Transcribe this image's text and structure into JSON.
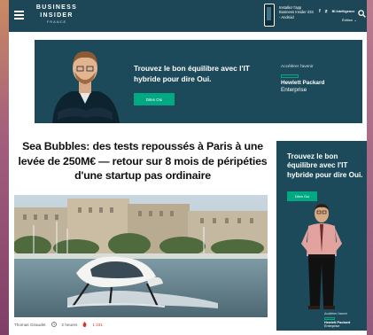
{
  "header": {
    "logo_line1": "BUSINESS",
    "logo_line2": "INSIDER",
    "logo_line3": "FRANCE",
    "app_promo": "Installez l'app Business Insider iOS - Android",
    "bi_intelligence": "BI Intelligence",
    "edition_label": "Édition ⌄",
    "colors": {
      "bar": "#1d4656",
      "accent": "#01a982"
    }
  },
  "ad_top": {
    "headline": "Trouvez le bon équilibre avec l'IT hybride pour dire Oui.",
    "cta_label": "Dites Oui",
    "caption": "Accélérer l'avenir",
    "brand_line1": "Hewlett Packard",
    "brand_line2": "Enterprise"
  },
  "article": {
    "headline": "Sea Bubbles: des tests repoussés à Paris à une levée de 250M€ — retour sur 8 mois de péripéties d'une startup pas ordinaire",
    "author": "Thomas Giraudet",
    "time": "2 heures",
    "views": "1 231",
    "photo_icon": "sea-bubble-photo"
  },
  "ad_side": {
    "headline": "Trouvez le bon équilibre avec l'IT hybride pour dire Oui.",
    "cta_label": "Dites Oui",
    "caption": "Accélérer l'avenir",
    "brand_line1": "Hewlett Packard",
    "brand_line2": "Enterprise"
  }
}
